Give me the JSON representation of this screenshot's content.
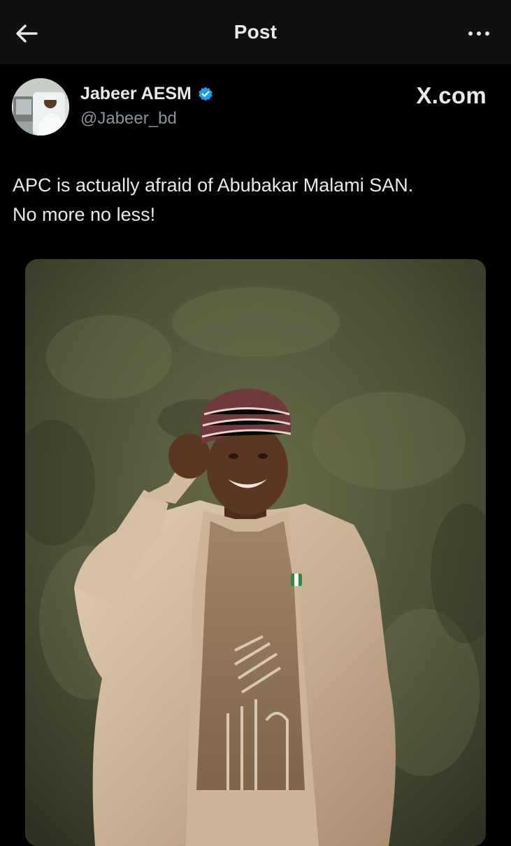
{
  "header": {
    "title": "Post",
    "back_icon": "arrow-left-icon",
    "more_icon": "more-horizontal-icon"
  },
  "author": {
    "name": "Jabeer AESM",
    "handle": "@Jabeer_bd",
    "verified": true,
    "verified_color": "#1d9bf0"
  },
  "watermark": "X.com",
  "post": {
    "text_line1": "APC is actually afraid of Abubakar Malami SAN.",
    "text_line2": "No more no less!"
  },
  "colors": {
    "background": "#000000",
    "topbar": "#0f1012",
    "text_primary": "#e7e9ea",
    "text_secondary": "#8b9298"
  }
}
